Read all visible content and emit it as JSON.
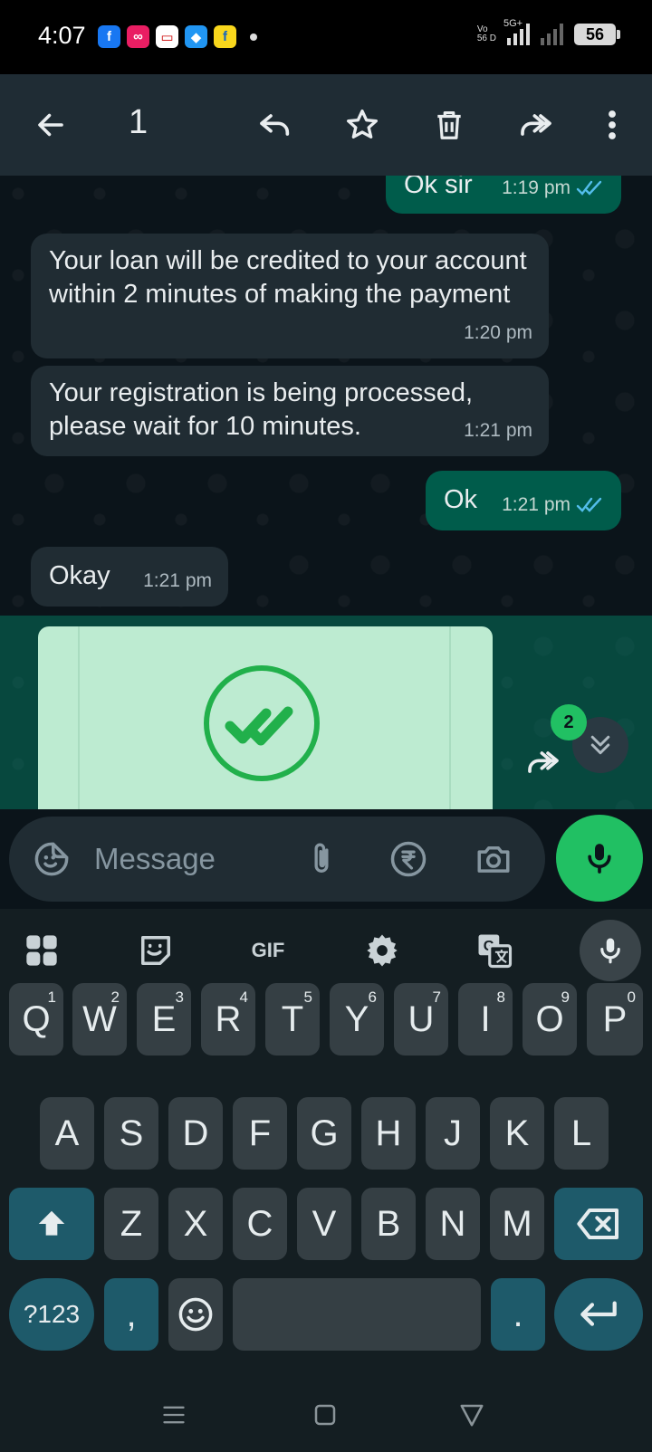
{
  "status_bar": {
    "time": "4:07",
    "network_top": "Vo",
    "network_bottom": "56 D",
    "network_5g": "5G+",
    "battery": "56"
  },
  "toolbar": {
    "selected_count": "1"
  },
  "messages": [
    {
      "text": "Ok sir",
      "time": "1:19 pm",
      "direction": "outgoing"
    },
    {
      "text": "Your loan will be credited to your account within 2 minutes of making the payment",
      "time": "1:20 pm",
      "direction": "incoming"
    },
    {
      "text": "Your registration is being processed, please wait for 10 minutes.",
      "time": "1:21 pm",
      "direction": "incoming"
    },
    {
      "text": "Ok",
      "time": "1:21 pm",
      "direction": "outgoing"
    },
    {
      "text": "Okay",
      "time": "1:21 pm",
      "direction": "incoming"
    }
  ],
  "scroll_badge": "2",
  "composer": {
    "placeholder": "Message"
  },
  "keyboard": {
    "row1": [
      {
        "k": "Q",
        "n": "1"
      },
      {
        "k": "W",
        "n": "2"
      },
      {
        "k": "E",
        "n": "3"
      },
      {
        "k": "R",
        "n": "4"
      },
      {
        "k": "T",
        "n": "5"
      },
      {
        "k": "Y",
        "n": "6"
      },
      {
        "k": "U",
        "n": "7"
      },
      {
        "k": "I",
        "n": "8"
      },
      {
        "k": "O",
        "n": "9"
      },
      {
        "k": "P",
        "n": "0"
      }
    ],
    "row2": [
      "A",
      "S",
      "D",
      "F",
      "G",
      "H",
      "J",
      "K",
      "L"
    ],
    "row3": [
      "Z",
      "X",
      "C",
      "V",
      "B",
      "N",
      "M"
    ],
    "symbols_key": "?123",
    "comma_key": ",",
    "period_key": ".",
    "gif_label": "GIF"
  },
  "colors": {
    "accent": "#21c063",
    "outgoing_bubble": "#005c4b",
    "incoming_bubble": "#202c33",
    "tick_blue": "#53bdeb"
  }
}
